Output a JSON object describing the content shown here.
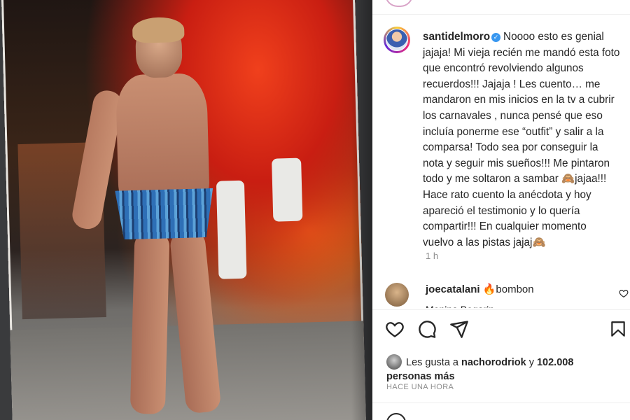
{
  "post": {
    "username": "santidelmoro",
    "verified": true,
    "caption": "Noooo esto es genial jajaja! Mi vieja recién me mandó esta foto que encontró revolviendo algunos recuerdos!!! Jajaja ! Les cuento… me mandaron en mis inicios en la tv a cubrir los carnavales , nunca pensé que eso incluía ponerme ese “outfit” y salir a la comparsa! Todo sea por conseguir la nota y seguir mis sueños!!! Me pintaron todo y me soltaron a sambar 🙈jajaa!!! Hace rato cuento la anécdota y hoy apareció el testimonio y lo quería compartir!!! En cualquier momento vuelvo a las pistas jajaj🙈",
    "time_ago": "1 h"
  },
  "comments": [
    {
      "username": "joecatalani",
      "text": "🔥bombon"
    }
  ],
  "comment_cut_text": "Monina Bogarin",
  "likes": {
    "prefix": "Les gusta a",
    "user": "nachorodriok",
    "connector": "y",
    "count": "102.008",
    "suffix": "personas más"
  },
  "posted_time": "HACE UNA HORA",
  "icons": {
    "like": "heart-icon",
    "comment": "comment-bubble-icon",
    "share": "paper-plane-icon",
    "save": "bookmark-icon",
    "comment_like": "heart-outline-icon",
    "emoji": "emoji-icon"
  },
  "colors": {
    "verified": "#3897f0",
    "secondary_text": "#8e8e8e",
    "text": "#262626"
  }
}
